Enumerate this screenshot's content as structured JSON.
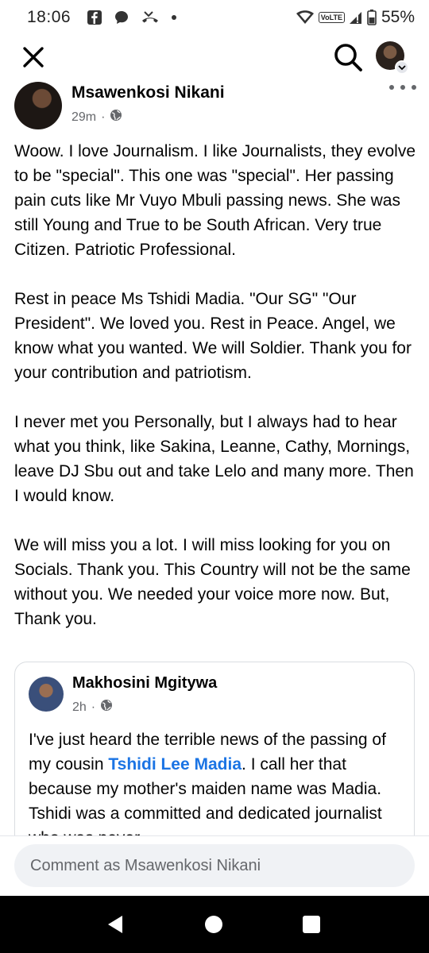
{
  "status_bar": {
    "time": "18:06",
    "battery_percent": "55%",
    "network_badge": "VoLTE",
    "left_icons": [
      "facebook-icon",
      "chat-bubble-icon",
      "missed-call-icon",
      "dot-icon"
    ],
    "right_icons": [
      "wifi-icon",
      "signal-icon",
      "battery-icon"
    ]
  },
  "top_nav": {
    "icons": [
      "close-icon",
      "search-icon",
      "profile-avatar"
    ]
  },
  "post": {
    "author": "Msawenkosi Nikani",
    "time": "29m",
    "separator": "·",
    "privacy_icon": "globe-icon",
    "paragraphs": [
      "Woow. I love Journalism. I like Journalists, they evolve to be \"special\". This one was \"special\". Her passing pain cuts like Mr Vuyo Mbuli passing news. She was still Young and True to be South African. Very true Citizen. Patriotic Professional.",
      "Rest in peace Ms Tshidi Madia. \"Our SG\" \"Our President\". We loved you. Rest in Peace. Angel, we know what you wanted. We will Soldier. Thank you for your contribution and patriotism.",
      "I never met you Personally, but I always had to hear what you think, like Sakina, Leanne, Cathy, Mornings, leave DJ Sbu out and take Lelo and many more. Then I would know.",
      "We will miss you a lot. I will miss looking for you on Socials. Thank you. This Country will not be the same without you. We needed your voice more now. But, Thank you."
    ]
  },
  "shared_post": {
    "author": "Makhosini Mgitywa",
    "time": "2h",
    "separator": "·",
    "text_before": "I've just heard the terrible news of the passing of my cousin ",
    "mention": "Tshidi Lee Madia",
    "text_after": ". I call her that because my mother's maiden name was Madia. Tshidi was a committed and dedicated journalist who was never"
  },
  "comment": {
    "placeholder": "Comment as Msawenkosi Nikani"
  },
  "colors": {
    "mention_blue": "#1b74e4",
    "meta_gray": "#65676b",
    "input_bg": "#f0f2f5"
  }
}
